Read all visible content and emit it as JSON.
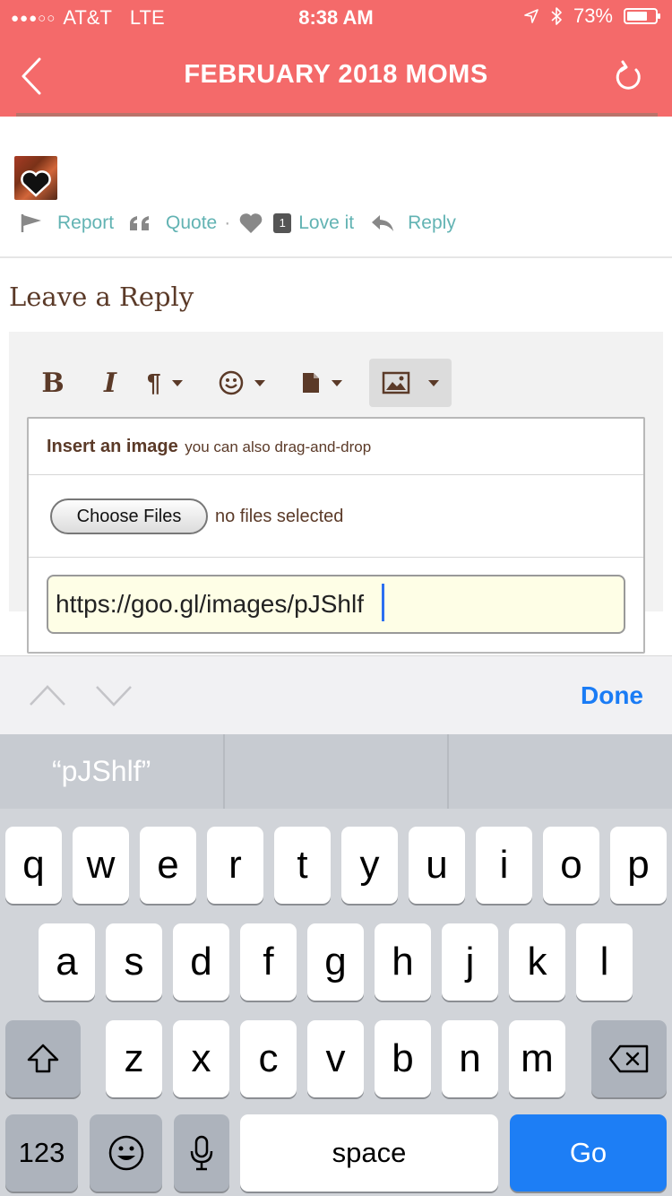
{
  "status_bar": {
    "signal_dots": "●●●○○",
    "carrier": "AT&T",
    "network": "LTE",
    "time": "8:38 AM",
    "battery_text": "73%",
    "battery_level": 0.73
  },
  "nav": {
    "title": "FEBRUARY 2018 MOMS"
  },
  "post_actions": {
    "report": "Report",
    "quote": "Quote",
    "separator": "·",
    "love_count": "1",
    "love": "Love it",
    "reply": "Reply"
  },
  "reply_section": {
    "title": "Leave a Reply"
  },
  "toolbar": {
    "bold": "B",
    "italic": "I",
    "paragraph": "¶"
  },
  "image_popup": {
    "heading": "Insert an image",
    "subheading": "you can also drag-and-drop",
    "choose_button": "Choose Files",
    "no_files": "no files selected",
    "url_value": "https://goo.gl/images/pJShlf"
  },
  "accessory": {
    "done": "Done"
  },
  "keyboard": {
    "prediction_1": "“pJShlf”",
    "prediction_2": "",
    "prediction_3": "",
    "row1": [
      "q",
      "w",
      "e",
      "r",
      "t",
      "y",
      "u",
      "i",
      "o",
      "p"
    ],
    "row2": [
      "a",
      "s",
      "d",
      "f",
      "g",
      "h",
      "j",
      "k",
      "l"
    ],
    "row3": [
      "z",
      "x",
      "c",
      "v",
      "b",
      "n",
      "m"
    ],
    "numbers_key": "123",
    "space_key": "space",
    "go_key": "Go"
  },
  "colors": {
    "header": "#f46a6a",
    "link": "#62b3b3",
    "brown_text": "#5b3a28",
    "ios_blue": "#1a7cf5"
  },
  "icons": [
    "back-chevron-icon",
    "refresh-icon",
    "flag-icon",
    "quote-icon",
    "heart-icon",
    "reply-arrow-icon",
    "paragraph-icon",
    "smiley-icon",
    "document-icon",
    "image-icon",
    "up-chevron-icon",
    "down-chevron-icon",
    "shift-icon",
    "backspace-icon",
    "emoji-icon",
    "microphone-icon"
  ]
}
